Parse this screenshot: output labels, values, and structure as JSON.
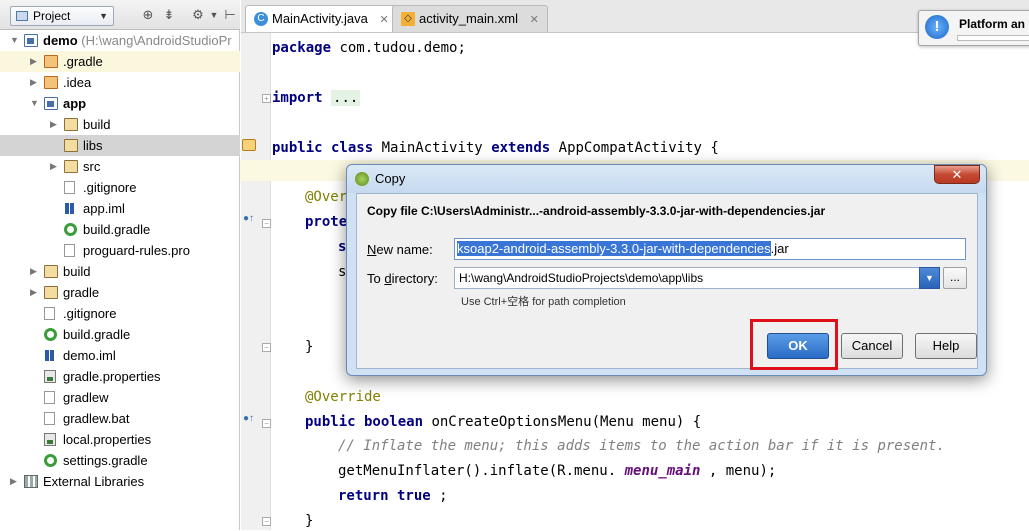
{
  "project_panel": {
    "view_selector": "Project",
    "tree": [
      {
        "label": "demo",
        "path": "(H:\\wang\\AndroidStudioPr",
        "bold": true,
        "icon": "module-icon",
        "indent": 0,
        "arrow": "down"
      },
      {
        "label": ".gradle",
        "icon": "folder-icon-orange",
        "indent": 1,
        "arrow": "right",
        "highlight": true
      },
      {
        "label": ".idea",
        "icon": "folder-icon-orange",
        "indent": 1,
        "arrow": "right"
      },
      {
        "label": "app",
        "icon": "module-icon",
        "indent": 1,
        "arrow": "down",
        "bold": true
      },
      {
        "label": "build",
        "icon": "folder-icon",
        "indent": 2,
        "arrow": "right"
      },
      {
        "label": "libs",
        "icon": "folder-icon",
        "indent": 2,
        "arrow": "",
        "selected": true
      },
      {
        "label": "src",
        "icon": "folder-icon",
        "indent": 2,
        "arrow": "right"
      },
      {
        "label": ".gitignore",
        "icon": "file-icon",
        "indent": 2,
        "arrow": ""
      },
      {
        "label": "app.iml",
        "icon": "iml-icon",
        "indent": 2,
        "arrow": ""
      },
      {
        "label": "build.gradle",
        "icon": "gradle-icon",
        "indent": 2,
        "arrow": ""
      },
      {
        "label": "proguard-rules.pro",
        "icon": "file-icon",
        "indent": 2,
        "arrow": ""
      },
      {
        "label": "build",
        "icon": "folder-icon",
        "indent": 1,
        "arrow": "right"
      },
      {
        "label": "gradle",
        "icon": "folder-icon",
        "indent": 1,
        "arrow": "right"
      },
      {
        "label": ".gitignore",
        "icon": "file-icon",
        "indent": 1,
        "arrow": ""
      },
      {
        "label": "build.gradle",
        "icon": "gradle-icon",
        "indent": 1,
        "arrow": ""
      },
      {
        "label": "demo.iml",
        "icon": "iml-icon",
        "indent": 1,
        "arrow": ""
      },
      {
        "label": "gradle.properties",
        "icon": "props-icon",
        "indent": 1,
        "arrow": ""
      },
      {
        "label": "gradlew",
        "icon": "file-icon",
        "indent": 1,
        "arrow": ""
      },
      {
        "label": "gradlew.bat",
        "icon": "file-icon",
        "indent": 1,
        "arrow": ""
      },
      {
        "label": "local.properties",
        "icon": "props-icon",
        "indent": 1,
        "arrow": ""
      },
      {
        "label": "settings.gradle",
        "icon": "gradle-icon",
        "indent": 1,
        "arrow": ""
      },
      {
        "label": "External Libraries",
        "icon": "library-icon",
        "indent": 0,
        "arrow": "right"
      }
    ]
  },
  "tabs": [
    {
      "label": "MainActivity.java",
      "icon": "java-class-icon",
      "active": true
    },
    {
      "label": "activity_main.xml",
      "icon": "xml-file-icon",
      "active": false
    }
  ],
  "editor": {
    "lines": [
      {
        "row": 0,
        "indent": 0,
        "parts": [
          [
            "kw",
            "package"
          ],
          [
            "",
            "com.tudou.demo;"
          ]
        ]
      },
      {
        "row": 2,
        "indent": 0,
        "parts": [
          [
            "kw",
            "import"
          ],
          [
            "fold-dots",
            "..."
          ]
        ]
      },
      {
        "row": 4,
        "indent": 0,
        "parts": [
          [
            "kw",
            "public class"
          ],
          [
            "",
            "MainActivity"
          ],
          [
            "kw",
            "extends"
          ],
          [
            "",
            "AppCompatActivity {"
          ]
        ]
      },
      {
        "row": 6,
        "indent": 1,
        "parts": [
          [
            "ann",
            "@Overr"
          ]
        ]
      },
      {
        "row": 7,
        "indent": 1,
        "parts": [
          [
            "kw",
            "prote"
          ]
        ]
      },
      {
        "row": 8,
        "indent": 2,
        "parts": [
          [
            "kw",
            "s"
          ]
        ]
      },
      {
        "row": 9,
        "indent": 2,
        "parts": [
          [
            "",
            "s"
          ]
        ]
      },
      {
        "row": 12,
        "indent": 1,
        "parts": [
          [
            "",
            "}"
          ]
        ]
      },
      {
        "row": 14,
        "indent": 1,
        "parts": [
          [
            "ann",
            "@Override"
          ]
        ]
      },
      {
        "row": 15,
        "indent": 1,
        "parts": [
          [
            "kw",
            "public boolean"
          ],
          [
            "",
            "onCreateOptionsMenu(Menu menu) {"
          ]
        ]
      },
      {
        "row": 16,
        "indent": 2,
        "parts": [
          [
            "cmt",
            "// Inflate the menu; this adds items to the action bar if it is present."
          ]
        ]
      },
      {
        "row": 17,
        "indent": 2,
        "parts": [
          [
            "",
            "getMenuInflater().inflate(R.menu."
          ],
          [
            "fld",
            "menu_main"
          ],
          [
            "",
            ", menu);"
          ]
        ]
      },
      {
        "row": 18,
        "indent": 2,
        "parts": [
          [
            "kw",
            "return true"
          ],
          [
            "",
            ";"
          ]
        ]
      },
      {
        "row": 19,
        "indent": 1,
        "parts": [
          [
            "",
            "}"
          ]
        ]
      }
    ]
  },
  "notification": {
    "text": "Platform an"
  },
  "dialog": {
    "title": "Copy",
    "heading": "Copy file C:\\Users\\Administr...-android-assembly-3.3.0-jar-with-dependencies.jar",
    "new_name_label_key": "N",
    "new_name_label_rest": "ew name:",
    "new_name_selected": "ksoap2-android-assembly-3.3.0-jar-with-dependencies",
    "new_name_suffix": ".jar",
    "to_dir_label_a": "To ",
    "to_dir_label_key": "d",
    "to_dir_label_rest": "irectory:",
    "to_directory": "H:\\wang\\AndroidStudioProjects\\demo\\app\\libs",
    "browse": "...",
    "hint": "Use Ctrl+空格 for path completion",
    "ok": "OK",
    "cancel": "Cancel",
    "help": "Help"
  }
}
